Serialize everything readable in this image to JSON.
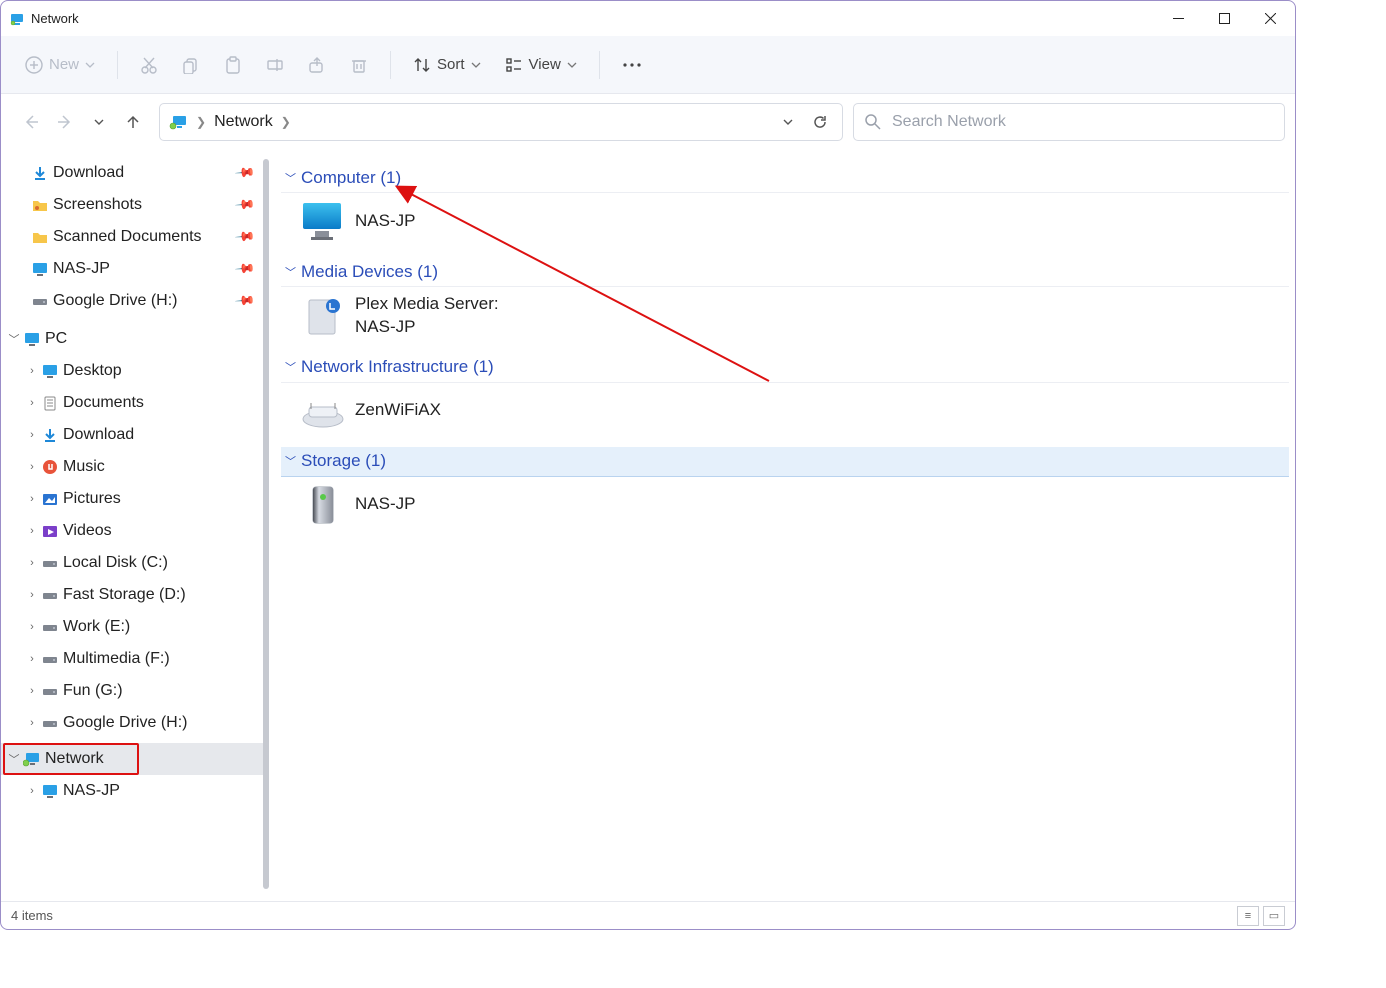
{
  "window": {
    "title": "Network"
  },
  "toolbar": {
    "new_label": "New",
    "sort_label": "Sort",
    "view_label": "View"
  },
  "address": {
    "crumb1": "Network"
  },
  "search": {
    "placeholder": "Search Network"
  },
  "sidebar": {
    "quick": [
      {
        "label": "Download"
      },
      {
        "label": "Screenshots"
      },
      {
        "label": "Scanned Documents"
      },
      {
        "label": "NAS-JP"
      },
      {
        "label": "Google Drive (H:)"
      }
    ],
    "pc_label": "PC",
    "pc_children": [
      {
        "label": "Desktop"
      },
      {
        "label": "Documents"
      },
      {
        "label": "Download"
      },
      {
        "label": "Music"
      },
      {
        "label": "Pictures"
      },
      {
        "label": "Videos"
      },
      {
        "label": "Local Disk (C:)"
      },
      {
        "label": "Fast Storage (D:)"
      },
      {
        "label": "Work (E:)"
      },
      {
        "label": "Multimedia (F:)"
      },
      {
        "label": "Fun (G:)"
      },
      {
        "label": "Google Drive (H:)"
      }
    ],
    "network_label": "Network",
    "network_children": [
      {
        "label": "NAS-JP"
      }
    ]
  },
  "content": {
    "groups": [
      {
        "title": "Computer (1)",
        "items": [
          {
            "line1": "NAS-JP"
          }
        ]
      },
      {
        "title": "Media Devices (1)",
        "items": [
          {
            "line1": "Plex Media Server:",
            "line2": "NAS-JP"
          }
        ]
      },
      {
        "title": "Network Infrastructure (1)",
        "items": [
          {
            "line1": "ZenWiFiAX"
          }
        ]
      },
      {
        "title": "Storage (1)",
        "items": [
          {
            "line1": "NAS-JP"
          }
        ],
        "selected": true
      }
    ]
  },
  "status": {
    "text": "4 items"
  }
}
